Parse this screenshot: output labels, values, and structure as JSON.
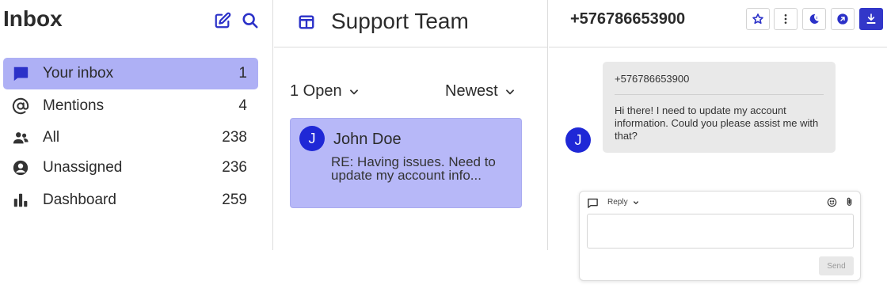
{
  "sidebar": {
    "title": "Inbox",
    "items": [
      {
        "label": "Your inbox",
        "count": "1",
        "icon": "chat-bubble-icon"
      },
      {
        "label": "Mentions",
        "count": "4",
        "icon": "at-sign-icon"
      },
      {
        "label": "All",
        "count": "238",
        "icon": "people-icon"
      },
      {
        "label": "Unassigned",
        "count": "236",
        "icon": "person-circle-icon"
      },
      {
        "label": "Dashboard",
        "count": "259",
        "icon": "bar-chart-icon"
      }
    ]
  },
  "middle": {
    "team_name": "Support Team",
    "filter_status": "1 Open",
    "sort_order": "Newest",
    "conversation": {
      "avatar_initial": "J",
      "name": "John Doe",
      "preview": "RE: Having issues. Need to update my account info..."
    }
  },
  "right": {
    "phone": "+576786653900",
    "message": {
      "avatar_initial": "J",
      "sender": "+576786653900",
      "text": "Hi there! I need to update my account information. Could you please assist me with that?"
    },
    "composer": {
      "reply_label": "Reply",
      "input_value": "",
      "send_label": "Send"
    }
  },
  "colors": {
    "accent": "#3237c9",
    "active_item_bg": "#aeb0f5",
    "card_bg": "#b7b8f8",
    "avatar_bg": "#1f28d6",
    "bubble_bg": "#e9e9e9"
  }
}
